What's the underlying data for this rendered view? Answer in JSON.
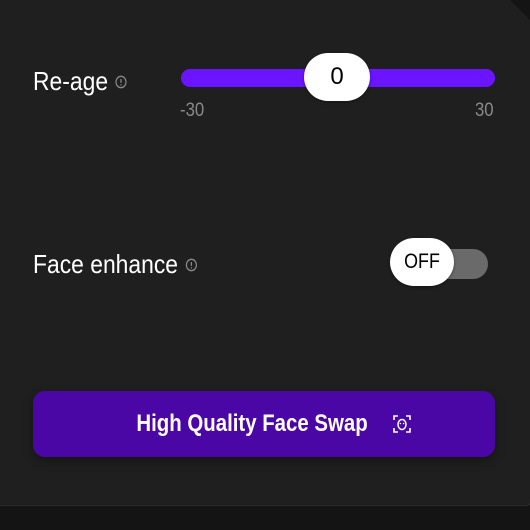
{
  "reage": {
    "label": "Re-age",
    "value": "0",
    "min_label": "-30",
    "max_label": "30",
    "min": -30,
    "max": 30,
    "current": 0
  },
  "face_enhance": {
    "label": "Face enhance",
    "state": "OFF"
  },
  "action": {
    "label": "High Quality Face Swap"
  },
  "colors": {
    "accent": "#6b14ff",
    "button": "#4a07a6",
    "panel": "#1f1f1f"
  },
  "icons": {
    "info": "info-icon",
    "face_scan": "face-scan-icon"
  }
}
